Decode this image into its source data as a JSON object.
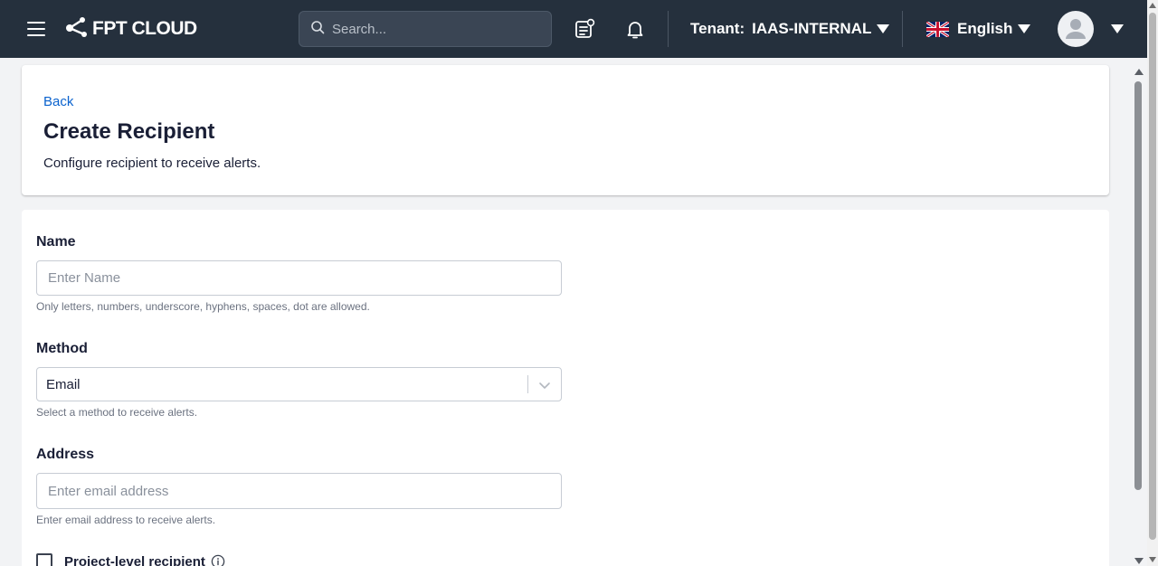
{
  "topbar": {
    "menu_icon": "hamburger-menu-icon",
    "brand": "FPT CLOUD",
    "logo_icon": "fpt-cloud-logo-icon",
    "search": {
      "placeholder": "Search...",
      "icon": "search-icon"
    },
    "requests_icon": "request-list-icon",
    "notification_icon": "bell-icon",
    "tenant": {
      "label": "Tenant:",
      "value": "IAAS-INTERNAL"
    },
    "language": {
      "label": "English",
      "flag_icon": "uk-flag-icon"
    },
    "avatar_icon": "user-avatar-icon",
    "colors": {
      "bar": "#25303d",
      "search_bg": "#3a4554"
    }
  },
  "header": {
    "back": "Back",
    "title": "Create Recipient",
    "subtitle": "Configure recipient to receive alerts."
  },
  "form": {
    "name": {
      "label": "Name",
      "placeholder": "Enter Name",
      "value": "",
      "hint": "Only letters, numbers, underscore, hyphens, spaces, dot are allowed."
    },
    "method": {
      "label": "Method",
      "value": "Email",
      "hint": "Select a method to receive alerts."
    },
    "address": {
      "label": "Address",
      "placeholder": "Enter email address",
      "value": "",
      "hint": "Enter email address to receive alerts."
    },
    "project_level": {
      "label": "Project-level recipient",
      "checked": false,
      "info_icon": "info-circle-icon"
    }
  },
  "colors": {
    "link": "#0b63ce",
    "text": "#1a1f36",
    "page_bg": "#f2f3f5"
  }
}
